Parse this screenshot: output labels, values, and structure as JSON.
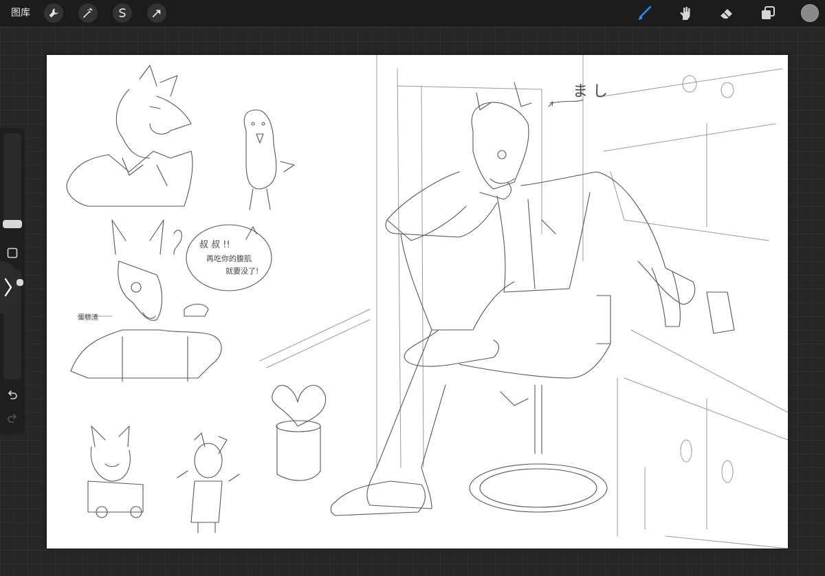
{
  "toolbar": {
    "gallery_label": "图库",
    "left_tools": [
      {
        "name": "wrench-icon",
        "label": "actions"
      },
      {
        "name": "magic-wand-icon",
        "label": "adjustments"
      },
      {
        "name": "selection-icon",
        "label": "selection"
      },
      {
        "name": "arrow-cursor-icon",
        "label": "transform"
      }
    ],
    "right_tools": [
      {
        "name": "brush-icon",
        "active": true
      },
      {
        "name": "smudge-icon",
        "active": false
      },
      {
        "name": "eraser-icon",
        "active": false
      },
      {
        "name": "layers-icon",
        "active": false
      }
    ],
    "current_color": "#8a8a8a",
    "active_color": "#2f8cf5"
  },
  "canvas": {
    "annotations": {
      "top_right": "ま し",
      "speech_line1": "叔 叔 !!",
      "speech_line2": "再吃你的腹肌",
      "speech_line3": "就要没了!",
      "cake_label": "蛋糕渣"
    }
  },
  "sidebar": {
    "brush_size": 0.15,
    "opacity": 0.95
  }
}
